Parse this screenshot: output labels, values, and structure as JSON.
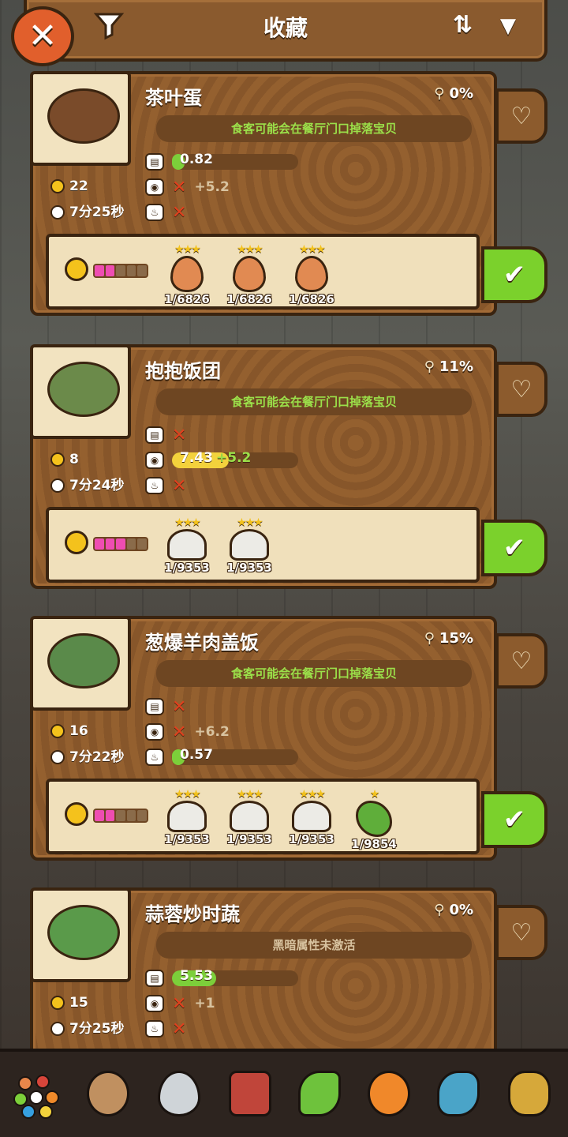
{
  "header": {
    "title": "收藏",
    "close_icon": "close-icon",
    "filter_icon": "filter-funnel-icon",
    "sort_icon": "sort-icon",
    "dropdown_icon": "chevron-down-icon"
  },
  "cards": [
    {
      "name": "茶叶蛋",
      "percent": "0%",
      "note": "食客可能会在餐厅门口掉落宝贝",
      "note_color": "#9be04a",
      "coins": "22",
      "time": "7分25秒",
      "stat1": {
        "value": "0.82",
        "bar": 0.05,
        "cross": false
      },
      "stat2": {
        "bonus": "+5.2",
        "cross": true
      },
      "stat3": {
        "cross": true
      },
      "progress_on": 2,
      "items": [
        {
          "type": "egg",
          "stars": "★★★",
          "count": "1/6826"
        },
        {
          "type": "egg",
          "stars": "★★★",
          "count": "1/6826"
        },
        {
          "type": "egg",
          "stars": "★★★",
          "count": "1/6826"
        }
      ]
    },
    {
      "name": "抱抱饭团",
      "percent": "11%",
      "note": "食客可能会在餐厅门口掉落宝贝",
      "note_color": "#9be04a",
      "coins": "8",
      "time": "7分24秒",
      "stat1": {
        "cross": true
      },
      "stat2": {
        "value": "7.43",
        "bonus": "+5.2",
        "bar": 0.45,
        "cross": false
      },
      "stat3": {
        "cross": true
      },
      "progress_on": 3,
      "items": [
        {
          "type": "rice",
          "stars": "★★★",
          "count": "1/9353"
        },
        {
          "type": "rice",
          "stars": "★★★",
          "count": "1/9353"
        }
      ]
    },
    {
      "name": "葱爆羊肉盖饭",
      "percent": "15%",
      "note": "食客可能会在餐厅门口掉落宝贝",
      "note_color": "#9be04a",
      "coins": "16",
      "time": "7分22秒",
      "stat1": {
        "cross": true
      },
      "stat2": {
        "bonus": "+6.2",
        "cross": true
      },
      "stat3": {
        "value": "0.57",
        "bar": 0.04,
        "cross": false
      },
      "progress_on": 2,
      "items": [
        {
          "type": "rice",
          "stars": "★★★",
          "count": "1/9353"
        },
        {
          "type": "rice",
          "stars": "★★★",
          "count": "1/9353"
        },
        {
          "type": "rice",
          "stars": "★★★",
          "count": "1/9353"
        },
        {
          "type": "veg",
          "stars": "★",
          "count": "1/9854"
        }
      ]
    },
    {
      "name": "蒜蓉炒时蔬",
      "percent": "0%",
      "note": "黑暗属性未激活",
      "note_color": "#d8c3a0",
      "coins": "15",
      "time": "7分25秒",
      "stat1": {
        "value": "5.53",
        "bar": 0.35,
        "cross": false
      },
      "stat2": {
        "bonus": "+1",
        "cross": true
      },
      "stat3": {
        "cross": true
      }
    }
  ],
  "bottom_nav": [
    "assorted-ingredients-icon",
    "egg-icon",
    "water-drop-icon",
    "meat-icon",
    "leaf-icon",
    "orange-icon",
    "fish-icon",
    "grain-icon"
  ]
}
